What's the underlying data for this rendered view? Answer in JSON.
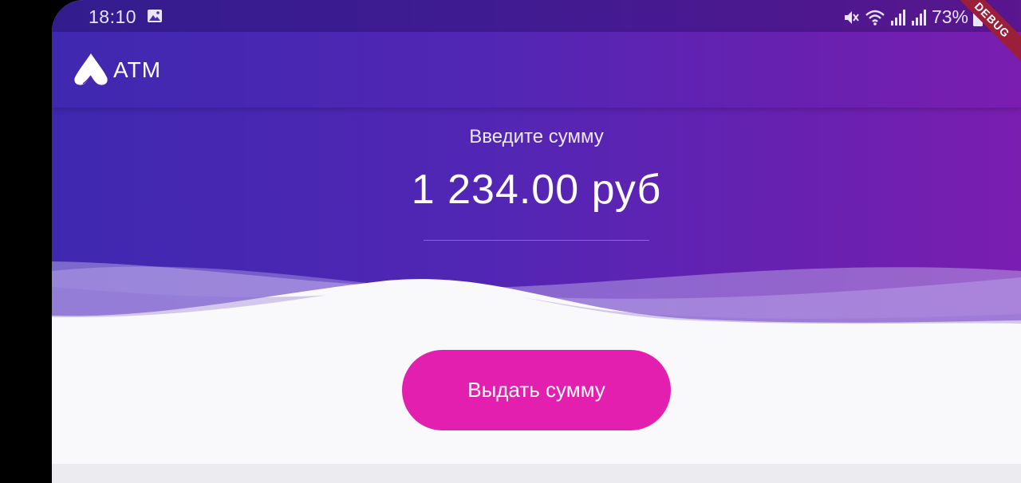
{
  "status_bar": {
    "time": "18:10",
    "battery": "73%",
    "icons": [
      "image-icon",
      "mute-icon",
      "wifi-icon",
      "signal-icon",
      "signal-icon",
      "battery-icon"
    ]
  },
  "app_bar": {
    "logo_text": "ATM",
    "logo_icon": "atm-logo-icon"
  },
  "amount": {
    "label": "Введите сумму",
    "value": "1 234.00 руб"
  },
  "actions": {
    "withdraw_label": "Выдать сумму"
  },
  "debug_banner": "DEBUG",
  "colors": {
    "gradient_start": "#3f28b0",
    "gradient_end": "#7a1eb0",
    "button": "#e31fb0",
    "background": "#f9f9fb"
  }
}
